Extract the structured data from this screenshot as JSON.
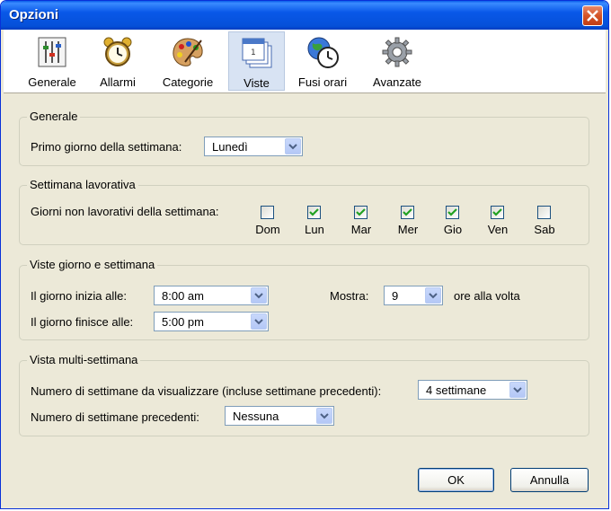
{
  "window": {
    "title": "Opzioni"
  },
  "toolbar": {
    "items": [
      {
        "label": "Generale",
        "icon": "sliders-icon"
      },
      {
        "label": "Allarmi",
        "icon": "alarm-clock-icon"
      },
      {
        "label": "Categorie",
        "icon": "palette-icon"
      },
      {
        "label": "Viste",
        "icon": "calendar-pages-icon"
      },
      {
        "label": "Fusi orari",
        "icon": "globe-clock-icon"
      },
      {
        "label": "Avanzate",
        "icon": "gear-icon"
      }
    ],
    "selected": "Viste"
  },
  "generale": {
    "legend": "Generale",
    "first_day_label": "Primo giorno della settimana:",
    "first_day_value": "Lunedì"
  },
  "settimana": {
    "legend": "Settimana lavorativa",
    "days_off_label": "Giorni non lavorativi della settimana:",
    "days": [
      {
        "label": "Dom",
        "checked": false
      },
      {
        "label": "Lun",
        "checked": true
      },
      {
        "label": "Mar",
        "checked": true
      },
      {
        "label": "Mer",
        "checked": true
      },
      {
        "label": "Gio",
        "checked": true
      },
      {
        "label": "Ven",
        "checked": true
      },
      {
        "label": "Sab",
        "checked": false
      }
    ]
  },
  "viste": {
    "legend": "Viste giorno e settimana",
    "start_label": "Il giorno inizia alle:",
    "start_value": "8:00 am",
    "end_label": "Il giorno finisce alle:",
    "end_value": "5:00 pm",
    "show_label": "Mostra:",
    "show_value": "9",
    "show_suffix": "ore alla volta"
  },
  "multi": {
    "legend": "Vista multi-settimana",
    "weeks_label": "Numero di settimane da visualizzare (incluse settimane precedenti):",
    "weeks_value": "4 settimane",
    "prev_label": "Numero di settimane precedenti:",
    "prev_value": "Nessuna"
  },
  "buttons": {
    "ok": "OK",
    "cancel": "Annulla"
  },
  "colors": {
    "titlebar": "#0550d8",
    "dialog_bg": "#ece9d8",
    "checkmark": "#21a121",
    "close": "#d45428"
  }
}
